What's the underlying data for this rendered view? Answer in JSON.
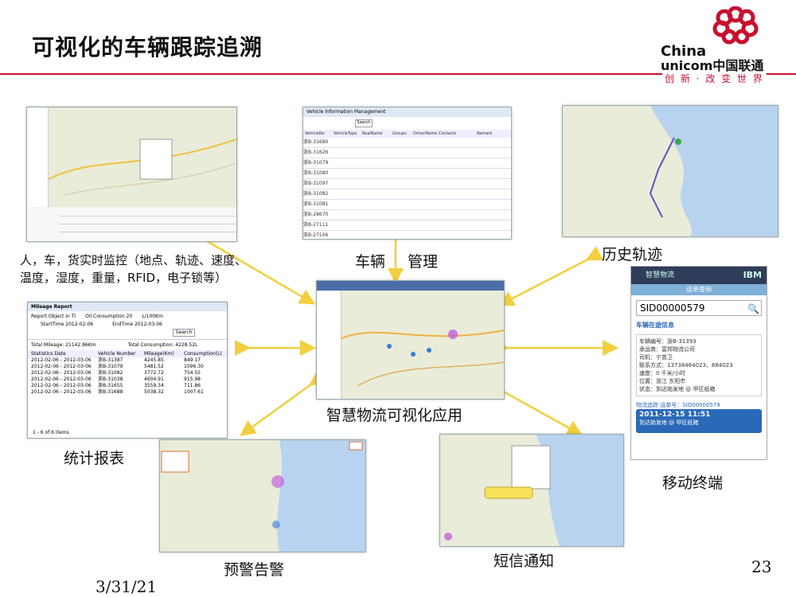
{
  "slide": {
    "title": "可视化的车辆跟踪追溯",
    "date": "3/31/21",
    "page_number": "23"
  },
  "logo": {
    "line1": "China",
    "line2": "unicom中国联通",
    "slogan": "创 新 · 改 变 世 界",
    "brand_color": "#c8102e"
  },
  "labels": {
    "monitor": "人，车，货实时监控（地点、轨迹、速度、温度，湿度，重量，RFID，电子锁等）",
    "vehicle": "车辆",
    "management": "管理",
    "history": "历史轨迹",
    "center": "智慧物流可视化应用",
    "mobile": "移动终端",
    "stats": "统计报表",
    "alert": "预警告警",
    "sms": "短信通知"
  },
  "vehicle_panel": {
    "title": "Vehicle Information Management",
    "search": "Search",
    "headers": [
      "VehicleNo",
      "VehicleType",
      "RealName",
      "Groups",
      "DriverName",
      "Contacts",
      "Remark"
    ],
    "rows": [
      "浙B-31680",
      "浙B-31626",
      "浙B-31079",
      "浙B-31080",
      "浙B-31097",
      "浙B-31082",
      "浙B-31081",
      "浙B-28670",
      "浙B-27111",
      "浙B-27106"
    ]
  },
  "mileage_panel": {
    "title": "Mileage Report",
    "object_label": "Report Object in TI",
    "oil_label": "Oil Consumption 20",
    "unit": "L/100Km",
    "start_label": "StartTime 2012-02-06",
    "end_label": "EndTime 2012-03-06",
    "search": "Search",
    "total_mileage": "Total Mileage: 21142.86Km",
    "total_consumption": "Total Consumption: 4228.52L",
    "headers": [
      "Statistics Date",
      "Vehicle Number",
      "Mileage(Km)",
      "Consumption(L)"
    ],
    "rows": [
      [
        "2012-02-06 - 2012-03-06",
        "浙B-31387",
        "4245.85",
        "849.17"
      ],
      [
        "2012-02-06 - 2012-03-06",
        "浙B-31079",
        "5481.52",
        "1096.30"
      ],
      [
        "2012-02-06 - 2012-03-06",
        "浙B-31082",
        "3772.72",
        "754.55"
      ],
      [
        "2012-02-06 - 2012-03-06",
        "浙B-31038",
        "4604.91",
        "915.98"
      ],
      [
        "2012-02-06 - 2012-03-06",
        "浙B-31655",
        "3559.34",
        "711.86"
      ],
      [
        "2012-02-06 - 2012-03-06",
        "浙B-31688",
        "5038.32",
        "1007.61"
      ]
    ],
    "footer": "1 - 6 of 6 items"
  },
  "mobile": {
    "header": "智慧物流",
    "brand": "IBM",
    "subtitle": "运单查询",
    "search_value": "SID00000579",
    "section": "车辆在途信息",
    "info": [
      "车辆编号：浙B-31393",
      "承运商：富邦物流公司",
      "司机：宁曾卫",
      "联系方式：13738464023、664023",
      "速度：0 千米/小时",
      "位置：浙江 东阳市",
      "状态：到达始发地 @ 甲区纸箱"
    ],
    "tracking_label": "物流追踪",
    "tracking_id": "运单号：SID00000579",
    "event_time": "2011-12-15 11:51",
    "event_text": "到达始发地 @ 甲区纸箱"
  },
  "colors": {
    "arrow": "#f2cf3e",
    "accent_red": "#c8102e",
    "mobile_dark": "#2f3d5a",
    "mobile_blue": "#2a69b8"
  }
}
